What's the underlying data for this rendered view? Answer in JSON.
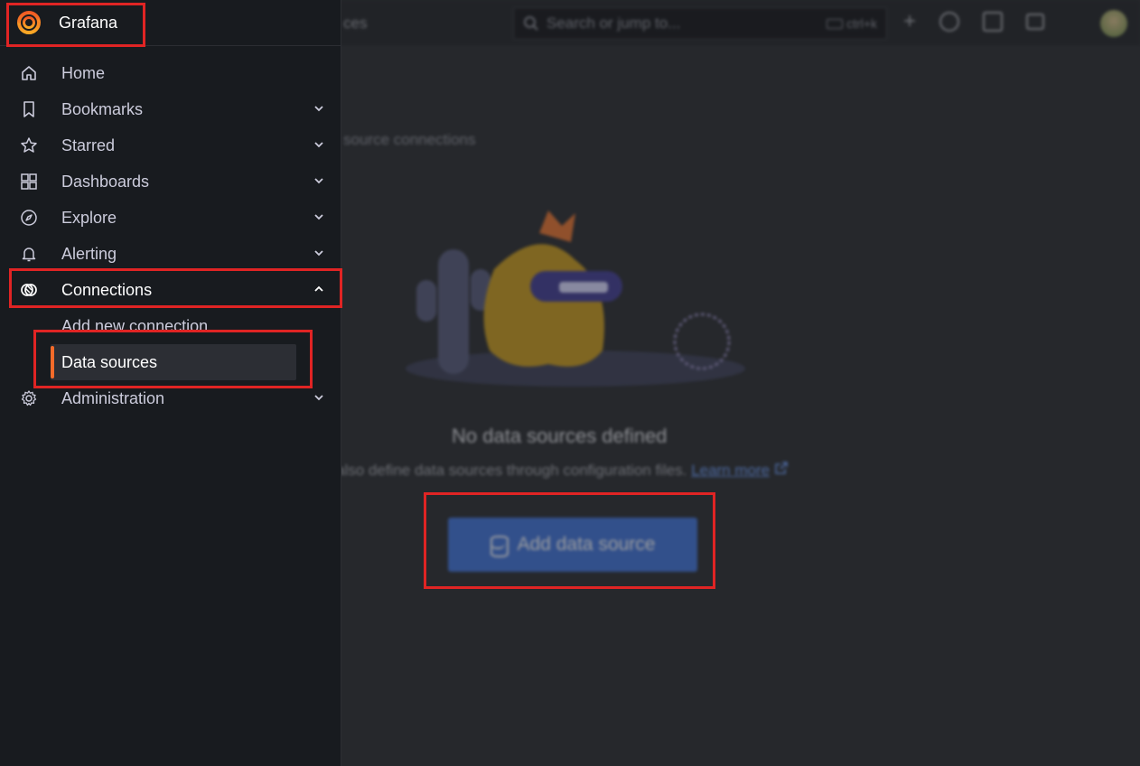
{
  "app": {
    "brand": "Grafana"
  },
  "topbar": {
    "breadcrumb_fragment": "ces",
    "search_placeholder": "Search or jump to...",
    "search_shortcut": "ctrl+k",
    "plus_label": "+"
  },
  "page": {
    "subtitle_fragment": "source connections",
    "empty_title": "No data sources defined",
    "empty_desc": "also define data sources through configuration files.",
    "learn_more": "Learn more",
    "add_button": "Add data source"
  },
  "sidebar": {
    "items": [
      {
        "label": "Home",
        "icon": "home-icon",
        "chevron": false
      },
      {
        "label": "Bookmarks",
        "icon": "bookmark-icon",
        "chevron": "down"
      },
      {
        "label": "Starred",
        "icon": "star-icon",
        "chevron": "down"
      },
      {
        "label": "Dashboards",
        "icon": "dashboards-icon",
        "chevron": "down"
      },
      {
        "label": "Explore",
        "icon": "compass-icon",
        "chevron": "down"
      },
      {
        "label": "Alerting",
        "icon": "bell-icon",
        "chevron": "down"
      },
      {
        "label": "Connections",
        "icon": "connections-icon",
        "chevron": "up"
      },
      {
        "label": "Administration",
        "icon": "gear-icon",
        "chevron": "down"
      }
    ],
    "connections_children": [
      {
        "label": "Add new connection",
        "selected": false
      },
      {
        "label": "Data sources",
        "selected": true
      }
    ]
  },
  "colors": {
    "accent_orange": "#f56b2a",
    "primary_button": "#3d71d9",
    "highlight_box": "#e02424"
  }
}
